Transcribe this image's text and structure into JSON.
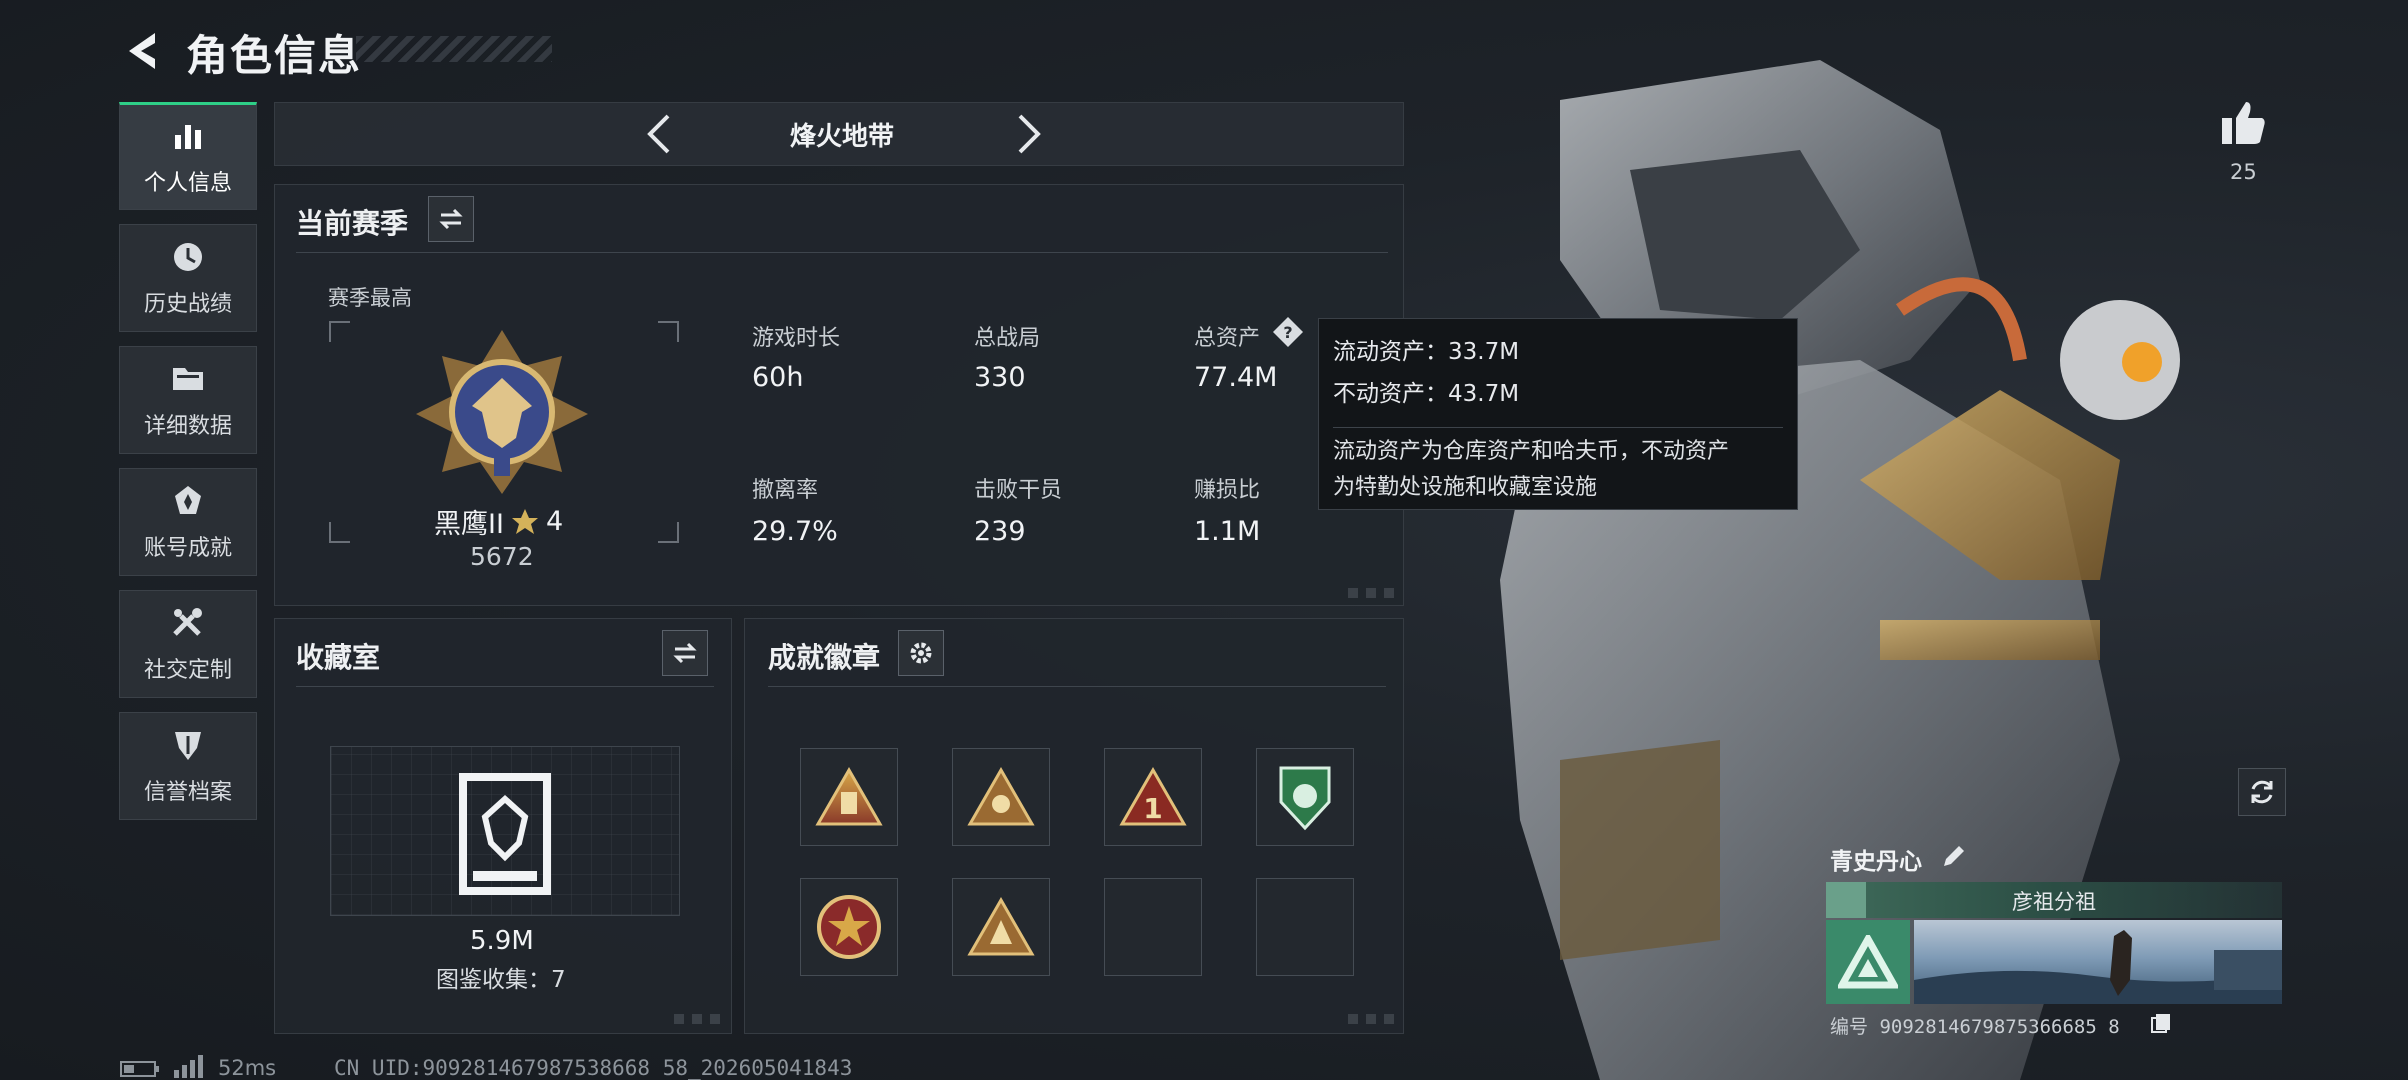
{
  "header": {
    "title": "角色信息"
  },
  "nav": [
    {
      "label": "个人信息",
      "icon": "bar-chart-icon"
    },
    {
      "label": "历史战绩",
      "icon": "clock-icon"
    },
    {
      "label": "详细数据",
      "icon": "folder-icon"
    },
    {
      "label": "账号成就",
      "icon": "medal-icon"
    },
    {
      "label": "社交定制",
      "icon": "tools-icon"
    },
    {
      "label": "信誉档案",
      "icon": "shield-icon"
    }
  ],
  "mode_selector": {
    "label": "烽火地带"
  },
  "season": {
    "title": "当前赛季",
    "best_label": "赛季最高",
    "rank_name": "黑鹰II",
    "rank_stars": "4",
    "rank_score": "5672",
    "stats": [
      {
        "label": "游戏时长",
        "value": "60h"
      },
      {
        "label": "总战局",
        "value": "330"
      },
      {
        "label": "总资产",
        "value": "77.4M"
      },
      {
        "label": "撤离率",
        "value": "29.7%"
      },
      {
        "label": "击败干员",
        "value": "239"
      },
      {
        "label": "赚损比",
        "value": "1.1M"
      }
    ]
  },
  "tooltip": {
    "liquid": "流动资产：33.7M",
    "fixed": "不动资产：43.7M",
    "desc_line1": "流动资产为仓库资产和哈夫币，不动资产",
    "desc_line2": "为特勤处设施和收藏室设施"
  },
  "collection": {
    "title": "收藏室",
    "value": "5.9M",
    "sub": "图鉴收集：7"
  },
  "achievements": {
    "title": "成就徽章",
    "badges": [
      "triangle-gold",
      "triangle-gold",
      "triangle-number-one",
      "shield-green",
      "round-star",
      "triangle-gold",
      "empty",
      "empty"
    ]
  },
  "like": {
    "count": "25"
  },
  "player": {
    "name": "青史丹心",
    "squad": "彦祖分祖",
    "id_text": "编号 9092814679875366685 8"
  },
  "status": {
    "ping": "52ms",
    "uid": "CN UID:909281467987538668 58_202605041843"
  },
  "colors": {
    "accent": "#2ecf87",
    "background": "#1c2127",
    "panel": "#21262c"
  }
}
